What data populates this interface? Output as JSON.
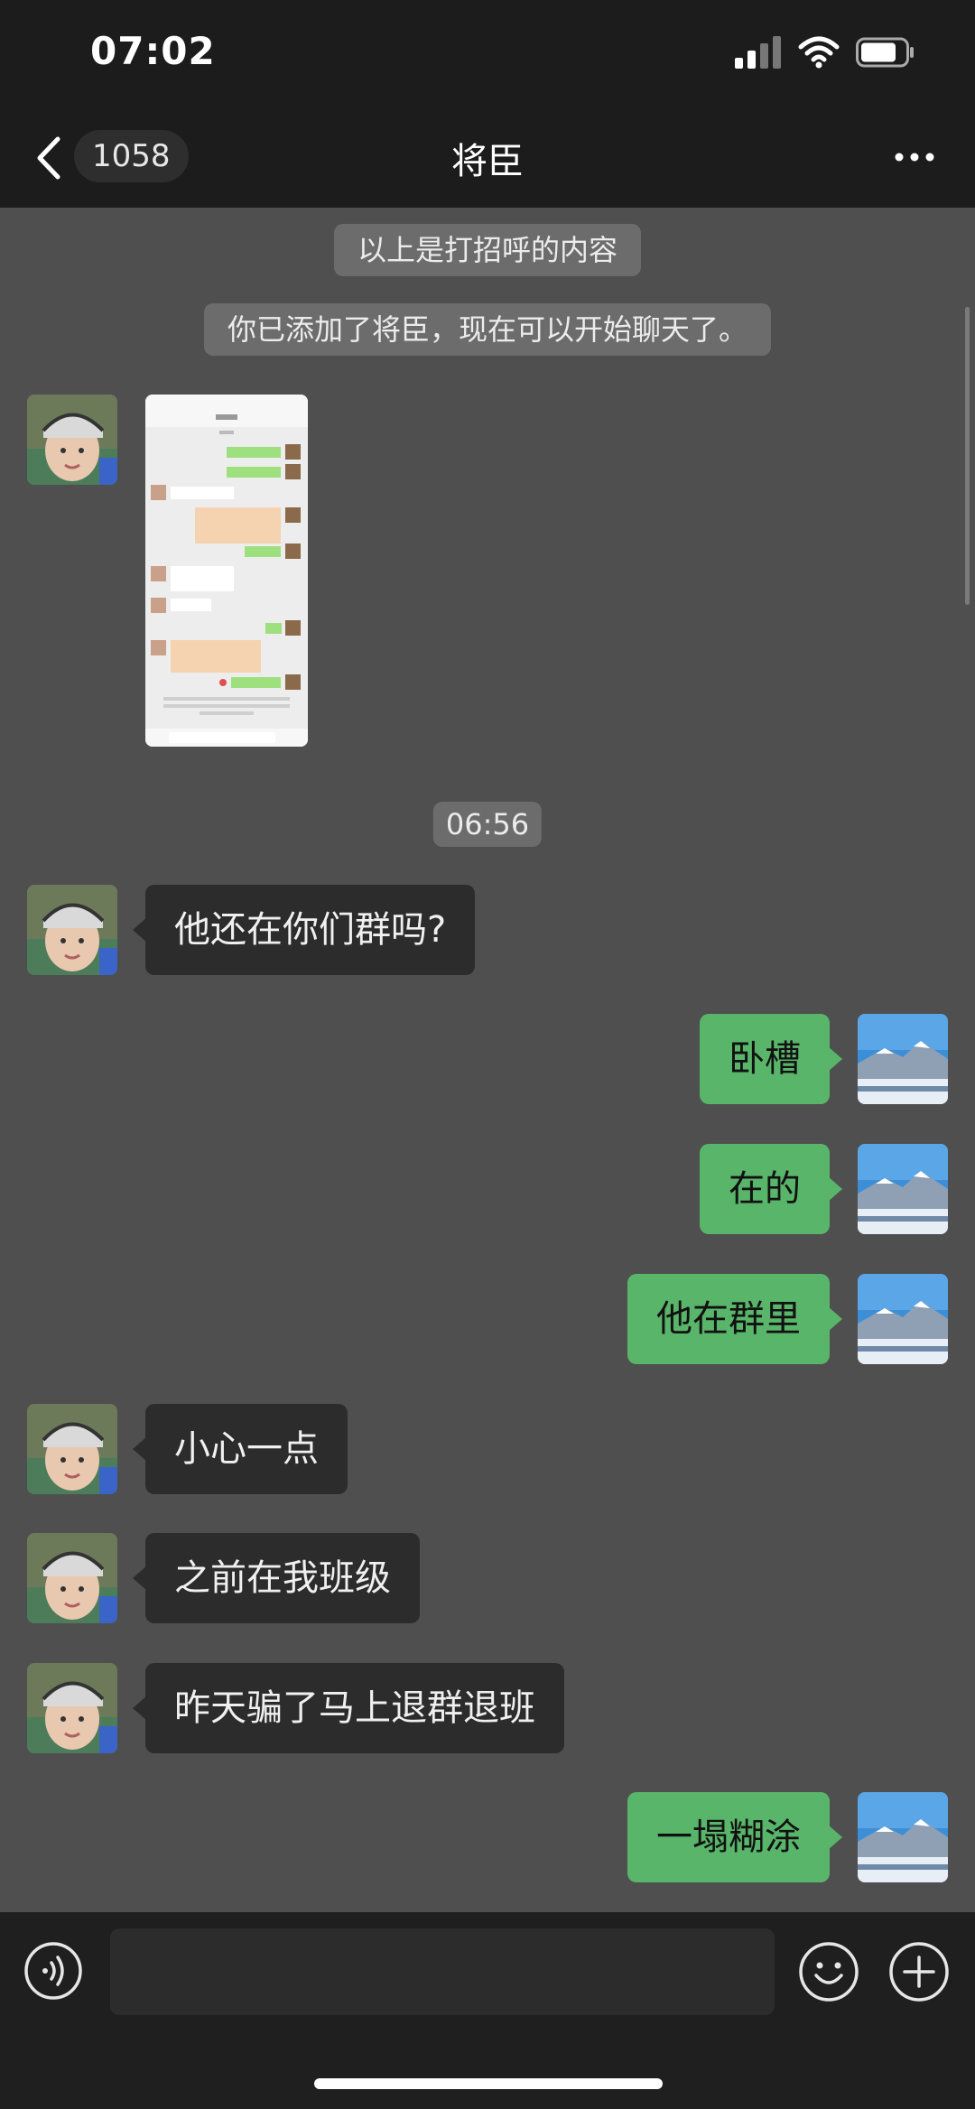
{
  "status_bar": {
    "time": "07:02"
  },
  "nav": {
    "back_count": "1058",
    "title": "将臣"
  },
  "chat": {
    "system_messages": [
      "以上是打招呼的内容",
      "你已添加了将臣，现在可以开始聊天了。"
    ],
    "timestamp": "06:56",
    "messages": [
      {
        "side": "left",
        "text": "他还在你们群吗?"
      },
      {
        "side": "right",
        "text": "卧槽"
      },
      {
        "side": "right",
        "text": "在的"
      },
      {
        "side": "right",
        "text": "他在群里"
      },
      {
        "side": "left",
        "text": "小心一点"
      },
      {
        "side": "left",
        "text": "之前在我班级"
      },
      {
        "side": "left",
        "text": "昨天骗了马上退群退班"
      },
      {
        "side": "right",
        "text": "一塌糊涂"
      }
    ]
  },
  "input_bar": {
    "placeholder": ""
  },
  "colors": {
    "chat_background": "#4f4f4f",
    "bar_background": "#1c1c1c",
    "incoming_bubble": "#2c2c2c",
    "outgoing_bubble": "#59b56a"
  }
}
